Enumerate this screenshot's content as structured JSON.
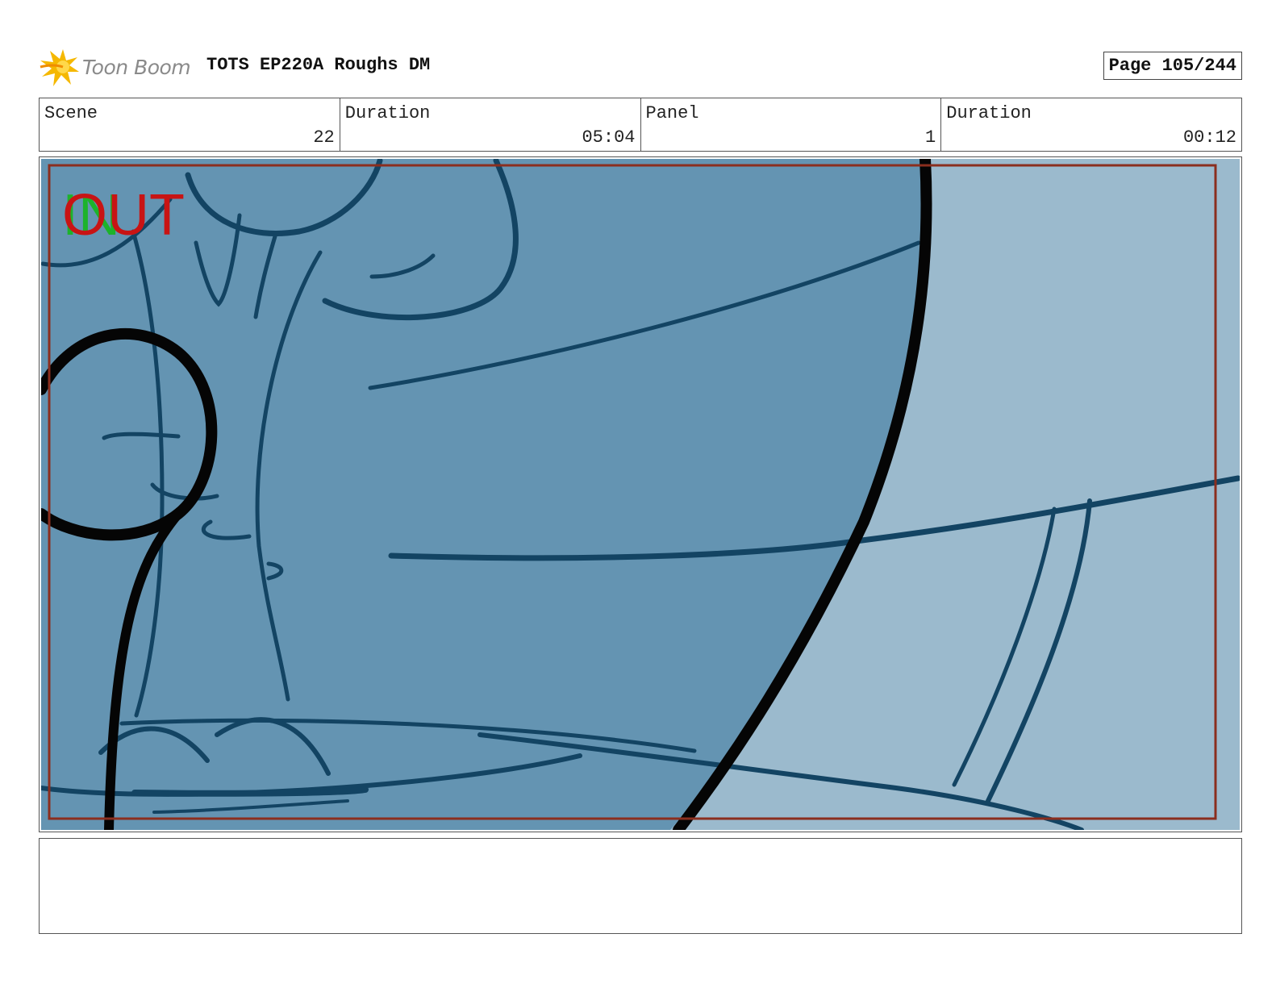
{
  "header": {
    "logo_text": "Toon Boom",
    "title": "TOTS EP220A Roughs DM",
    "page": "Page 105/244"
  },
  "info": {
    "scene_label": "Scene",
    "scene_value": "22",
    "scene_duration_label": "Duration",
    "scene_duration_value": "05:04",
    "panel_label": "Panel",
    "panel_value": "1",
    "panel_duration_label": "Duration",
    "panel_duration_value": "00:12"
  },
  "panel": {
    "marker_in": "IN",
    "marker_out": "OUT"
  },
  "colors": {
    "bg_dark": "#6494b2",
    "bg_light": "#9bbacd",
    "stroke": "#134463",
    "frame_red": "#8b2e1e",
    "in_green": "#1db32b",
    "out_red": "#c81414"
  },
  "notes": ""
}
